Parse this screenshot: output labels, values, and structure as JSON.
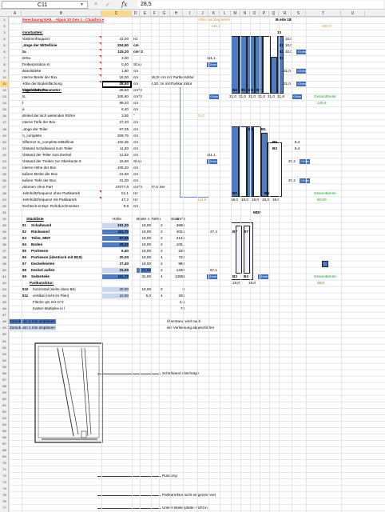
{
  "formula_bar": {
    "cell_ref": "C11",
    "fx": "fx",
    "value": "28,5",
    "cancel": "×",
    "enter": "✓"
  },
  "columns": [
    "A",
    "B",
    "C",
    "D",
    "E",
    "F",
    "G",
    "H",
    "I",
    "J",
    "K",
    "L",
    "M",
    "N",
    "O",
    "P",
    "Q",
    "R",
    "S",
    "T",
    "U"
  ],
  "selected_column": "C",
  "rows": [
    "1",
    "2",
    "3",
    "4",
    "5",
    "6",
    "7",
    "8",
    "9",
    "10",
    "11",
    "12",
    "13",
    "14",
    "15",
    "16",
    "17",
    "18",
    "19",
    "20",
    "21",
    "22",
    "23",
    "24",
    "25",
    "26",
    "27",
    "28",
    "29",
    "30",
    "31",
    "32",
    "33",
    "34",
    "35",
    "36",
    "37",
    "38",
    "39",
    "40",
    "41",
    "42",
    "43",
    "44",
    "45",
    "46",
    "47",
    "48",
    "49",
    "50",
    "51",
    "52",
    "53",
    "54",
    "55",
    "56",
    "57",
    "58",
    "59",
    "60",
    "61",
    "62",
    "63",
    "64",
    "65",
    "66",
    "67",
    "68",
    "69",
    "70",
    "71",
    "72",
    "73",
    "74",
    "75",
    "76",
    "77"
  ],
  "selected_row": "11",
  "sheet": {
    "title": "Berechnung NAIL - Alpair 10 Gen 1 - Chairforce",
    "segment_hint": "Höhe der Segmente",
    "segment_hint_val": "111,1",
    "top_right_val": "102,0",
    "breite_label": "Breite 18!",
    "konstanten": "Konstanten:",
    "abgeleitete": "Abgeleitete Parameter:",
    "rows_a": [
      {
        "label": "Abstimmfrequenz",
        "val": "42,00",
        "unit": "Hz"
      },
      {
        "label": "Länge der Mittellinie",
        "val": "204,50",
        "unit": "cm",
        "bold": true
      },
      {
        "label": "Sa",
        "val": "115,20",
        "unit": "cm^2",
        "bold": true
      },
      {
        "label": "Sl/Sa",
        "val": "3,00",
        "unit": ""
      },
      {
        "label": "Treiberposition Ki",
        "val": "0,40",
        "unit": "Sl:ak"
      },
      {
        "label": "Wandstärke",
        "val": "1,80",
        "unit": "cm"
      },
      {
        "label": "interne Breite der Box",
        "val": "18,00",
        "unit": "cm",
        "extra": "18,00  cm mit Partkarsrktur"
      },
      {
        "label": "Höhe der Bodenflächung",
        "val": "5,00",
        "unit": "cm",
        "extra": "3,20  cm mit Partkarsrktur"
      },
      {
        "label": "Karten Multiplex",
        "val": "28,50",
        "unit": "cm^2"
      }
    ],
    "rows_b": [
      {
        "label": "SL",
        "val": "345,60",
        "unit": "cm^2"
      },
      {
        "label": "lt",
        "val": "99,20",
        "unit": "cm"
      },
      {
        "label": "la",
        "val": "6,40",
        "unit": "cm"
      },
      {
        "label": "Winkel der sich weitenden Röhre",
        "val": "3,55",
        "unit": "°"
      },
      {
        "label": "interne Tiefe der Box",
        "val": "27,40",
        "unit": "cm"
      },
      {
        "label": "Länge der Teiler",
        "val": "97,05",
        "unit": "cm"
      },
      {
        "label": "m_complete",
        "val": "209,75",
        "unit": "cm"
      },
      {
        "label": "Differenz m_complete-Mittellinie",
        "val": "102,25",
        "unit": "cm"
      },
      {
        "label": "Abstand Schallwand zum Teiler",
        "val": "11,60",
        "unit": "cm"
      },
      {
        "label": "Abstand der Teiler zum Deckel",
        "val": "12,82",
        "unit": "cm"
      },
      {
        "label": "Abstand der Treiber zur Oberkante 8",
        "val": "16,90",
        "unit": "Sl:ak"
      },
      {
        "label": "interne Höhe der Box",
        "val": "106,20",
        "unit": "cm"
      },
      {
        "label": "äußere Breite der Box",
        "val": "21,60",
        "unit": "cm"
      },
      {
        "label": "äußere Tiefe der Box",
        "val": "31,00",
        "unit": "cm"
      },
      {
        "label": "Volumen ohne Part",
        "val": "47077,6",
        "unit": "cm^3",
        "extra": "47,6  liter"
      },
      {
        "label": "Helmholtzfrequenz ohne Partikarsrk",
        "val": "51,1",
        "unit": "Hz"
      },
      {
        "label": "Helmholtzfrequenz mit Partikarsrk",
        "val": "47,2",
        "unit": "Hz"
      },
      {
        "label": "Rechteck-entspr. Rohrdurchmesser",
        "val": "9,9",
        "unit": "cm"
      }
    ],
    "r22_val": "74,2",
    "r28_val": "114,9",
    "stueckliste": "Stückliste",
    "stk_headers": [
      "Höhe",
      "Breite",
      "x",
      "Tiefe",
      "x",
      "Stück",
      "cm^2"
    ],
    "parts": [
      {
        "id": "B1",
        "name": "Schallwand",
        "h": "101,20",
        "b": "18,00",
        "n": "2",
        "a": "3650"
      },
      {
        "id": "B2",
        "name": "Rückwand",
        "h": "111,70",
        "b": "18,00",
        "n": "2",
        "a": "4024"
      },
      {
        "id": "B3",
        "name": "Teiler, MDF",
        "h": "87,05",
        "b": "18,00",
        "n": "2",
        "a": "3134"
      },
      {
        "id": "B4",
        "name": "Boden",
        "h": "29,20",
        "b": "18,00",
        "n": "2",
        "a": "1051"
      },
      {
        "id": "B5",
        "name": "Portineon",
        "h": "6,40",
        "b": "18,00",
        "n": "2",
        "a": "230"
      },
      {
        "id": "B6",
        "name": "Portineon (identisch mit B10)",
        "h": "20,00",
        "b": "18,00",
        "n": "4",
        "a": "720"
      },
      {
        "id": "B7",
        "name": "Deckelleisten",
        "h": "27,40",
        "b": "18,00",
        "n": "2",
        "a": "986"
      },
      {
        "id": "B8",
        "name": "Deckel außen",
        "h": "31,00",
        "b": "21,60",
        "n": "2",
        "a": "1339"
      },
      {
        "id": "B9",
        "name": "Seitenteile",
        "h": "111,70",
        "b": "31,00",
        "n": "4",
        "a": "13851"
      }
    ],
    "partkarsrktur": "Partkarsrktur:",
    "pk": [
      {
        "id": "B10",
        "name": "horizontal (siehe oben B6)",
        "h": "20,00",
        "b": "18,00",
        "n": "0",
        "a": "0"
      },
      {
        "id": "B11",
        "name": "vertikal (nicht im Plan)",
        "h": "10,00",
        "b": "5,0",
        "n": "4",
        "a": "200"
      }
    ],
    "flaeche": "Fläche qm mit m^2",
    "flaeche_val": "2,6",
    "karten": "Karten Multiplex in l",
    "karten_val": "73",
    "zurueck2": "Zurück von 2 mm einplanen",
    "zurueck1": "Zurück von 1 mm einplanen",
    "oberstand": "Überstand wird nach",
    "oberstand2": "der Verleimung abgeschliffen",
    "gesamt1": "Gesamtbreite:",
    "gesamt1_val": "145,6",
    "gesamt2": "Gesamtbreite:",
    "gesamt2_val": "90,00",
    "gesamt3": "Gesamtbreite:",
    "gesamt3_val": "26,0",
    "val_74_2": "74,2",
    "mdf": "MDF",
    "ann_schallwand": "Schallwand abschräge",
    "ann_rundung": "Rundung",
    "ann_partkar": "Partkarsrktur nicht eingezeichnet",
    "ann_boden": "Untere Bodenplatte: nicht in",
    "d1": {
      "b_labels": [
        "B1",
        "B2",
        "B3",
        "B4",
        "B5",
        "B6",
        "B7"
      ],
      "side_vals": [
        "10,0",
        "10,0",
        "10,0",
        "31,0",
        "31,0"
      ],
      "plus": [
        "+1mm",
        "+2mm",
        "+2mm"
      ],
      "bottom": [
        "+2mm",
        "31,0",
        "31,0",
        "31,0",
        "31,0",
        "31,0",
        "21,6",
        "+2mm"
      ],
      "top_n": "10",
      "mid_val": "111,1"
    },
    "d2": {
      "labels": [
        "B1",
        "B1",
        "B3",
        "B5",
        "B2",
        "B4"
      ],
      "right_vals": [
        "6,4",
        "6,4",
        "29,2",
        "29,2"
      ],
      "mid_val": "111,1",
      "bottom": [
        "18,0",
        "18,0",
        "18,0",
        "18,0",
        "18,0"
      ],
      "plus": [
        "+1mm",
        "+2mm",
        "+1mm"
      ]
    },
    "d3": {
      "labels": [
        "B7",
        "B7",
        "B3",
        "B3"
      ],
      "left_val": "27,4",
      "mid_val": "67,1",
      "bottom": [
        "18,0",
        "18,0"
      ],
      "plus": [
        "+1mm",
        "+1mm"
      ]
    }
  }
}
